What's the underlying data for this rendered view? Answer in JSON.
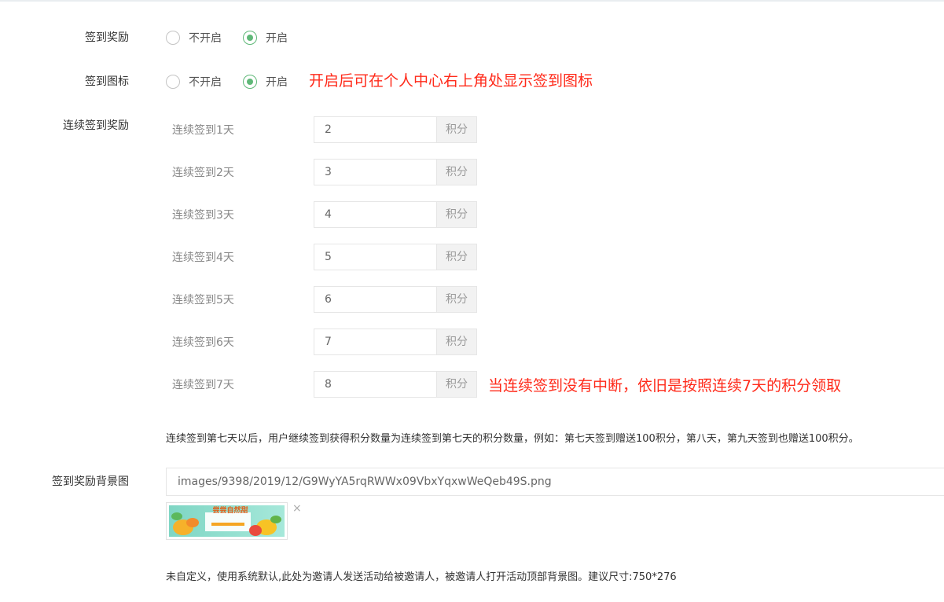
{
  "form": {
    "sign_reward": {
      "label": "签到奖励",
      "options": [
        "不开启",
        "开启"
      ],
      "selected": "开启"
    },
    "sign_icon": {
      "label": "签到图标",
      "options": [
        "不开启",
        "开启"
      ],
      "selected": "开启",
      "annotation": "开启后可在个人中心右上角处显示签到图标"
    },
    "continuous": {
      "label": "连续签到奖励",
      "unit": "积分",
      "days": [
        {
          "label": "连续签到1天",
          "value": "2"
        },
        {
          "label": "连续签到2天",
          "value": "3"
        },
        {
          "label": "连续签到3天",
          "value": "4"
        },
        {
          "label": "连续签到4天",
          "value": "5"
        },
        {
          "label": "连续签到5天",
          "value": "6"
        },
        {
          "label": "连续签到6天",
          "value": "7"
        },
        {
          "label": "连续签到7天",
          "value": "8"
        }
      ],
      "annotation": "当连续签到没有中断，依旧是按照连续7天的积分领取",
      "hint": "连续签到第七天以后，用户继续签到获得积分数量为连续签到第七天的积分数量，例如：第七天签到赠送100积分，第八天，第九天签到也赠送100积分。"
    },
    "background": {
      "label": "签到奖励背景图",
      "path": "images/9398/2019/12/G9WyYA5rqRWWx09VbxYqxwWeQeb49S.png",
      "thumb_text": "尝尝自然甜",
      "close": "×",
      "hint": "未自定义，使用系统默认,此处为邀请人发送活动给被邀请人，被邀请人打开活动顶部背景图。建议尺寸:750*276"
    }
  },
  "colors": {
    "accent": "#5fb878",
    "annotation": "#ff2a1a"
  }
}
